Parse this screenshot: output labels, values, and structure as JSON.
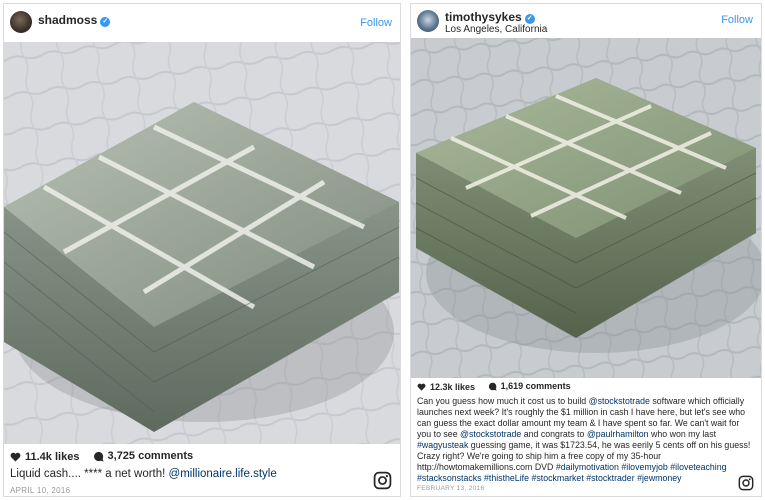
{
  "left_post": {
    "username": "shadmoss",
    "follow_label": "Follow",
    "likes": "11.4k likes",
    "comments": "3,725 comments",
    "caption_prefix": "Liquid cash.... **** a net worth! ",
    "caption_mention": "@millionaire.life.style",
    "date": "APRIL 10, 2016"
  },
  "right_post": {
    "username": "timothysykes",
    "location": "Los Angeles, California",
    "follow_label": "Follow",
    "likes": "12.3k likes",
    "comments": "1,619 comments",
    "caption_parts": [
      {
        "t": "Can you guess how much it cost us to build ",
        "link": false
      },
      {
        "t": "@stockstotrade",
        "link": true
      },
      {
        "t": " software which officially launches next week? It's roughly the $1 million in cash I have here, but let's see who can guess the exact dollar amount my team & I have spent so far. We can't wait for you to see ",
        "link": false
      },
      {
        "t": "@stockstotrade",
        "link": true
      },
      {
        "t": " and congrats to ",
        "link": false
      },
      {
        "t": "@paulrhamilton",
        "link": true
      },
      {
        "t": " who won my last ",
        "link": false
      },
      {
        "t": "#wagyusteak",
        "link": true
      },
      {
        "t": " guessing game, it was $1723.54, he was eerily 5 cents off on his guess! Crazy right? We're going to ship him a free copy of my 35-hour http://howtomakemillions.com DVD ",
        "link": false
      },
      {
        "t": "#dailymotivation",
        "link": true
      },
      {
        "t": " ",
        "link": false
      },
      {
        "t": "#ilovemyjob",
        "link": true
      },
      {
        "t": " ",
        "link": false
      },
      {
        "t": "#iloveteaching",
        "link": true
      },
      {
        "t": " ",
        "link": false
      },
      {
        "t": "#stacksonstacks",
        "link": true
      },
      {
        "t": " ",
        "link": false
      },
      {
        "t": "#thistheLife",
        "link": true
      },
      {
        "t": " ",
        "link": false
      },
      {
        "t": "#stockmarket",
        "link": true
      },
      {
        "t": " ",
        "link": false
      },
      {
        "t": "#stocktrader",
        "link": true
      },
      {
        "t": " ",
        "link": false
      },
      {
        "t": "#jewmoney",
        "link": true
      }
    ],
    "date": "FEBRUARY 13, 2016"
  },
  "icons": {
    "verified": "verified-badge-icon",
    "heart": "heart-icon",
    "comment": "comment-icon",
    "instagram": "instagram-logo-icon"
  },
  "colors": {
    "link": "#003569",
    "follow": "#3897f0",
    "date": "#999999",
    "border": "#dbdbdb"
  }
}
